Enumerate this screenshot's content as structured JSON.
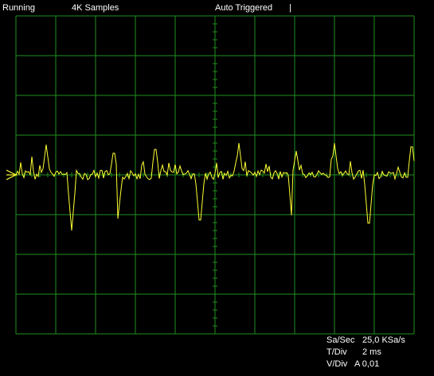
{
  "status": {
    "run_state": "Running",
    "samples": "4K Samples",
    "trigger_mode": "Auto Triggered",
    "trigger_marker": "|"
  },
  "readout": {
    "samples_per_sec_label": "Sa/Sec",
    "samples_per_sec_value": "25,0 KSa/s",
    "time_div_label": "T/Div",
    "time_div_value": "2 ms",
    "volt_div_label": "V/Div",
    "volt_div_value": "A 0,01"
  },
  "colors": {
    "background": "#000000",
    "grid": "#1f8f1f",
    "trace": "#ffff33",
    "text": "#ffffff"
  },
  "display": {
    "horizontal_divisions": 10,
    "vertical_divisions": 8
  }
}
